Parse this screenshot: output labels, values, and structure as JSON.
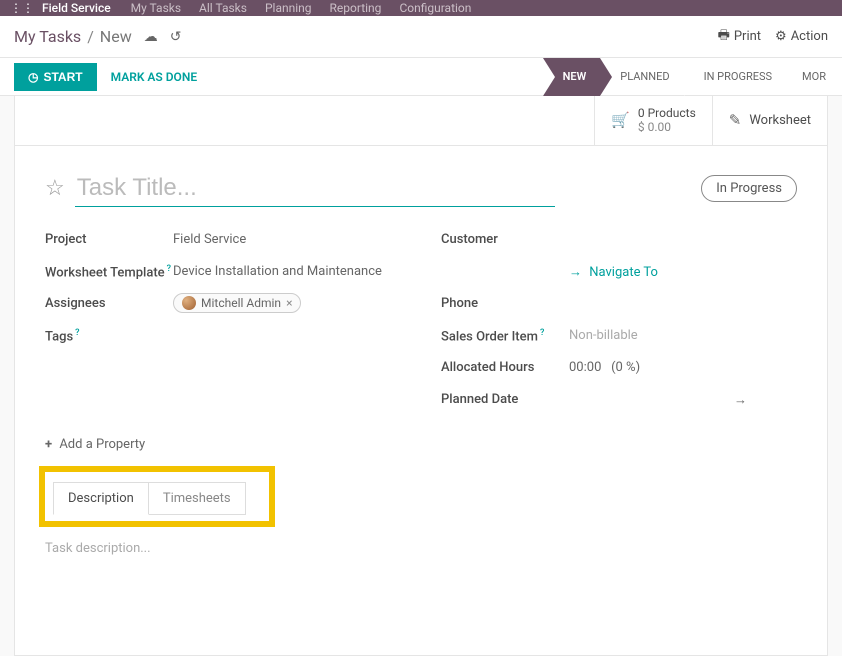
{
  "nav": {
    "brand": "Field Service",
    "items": [
      "My Tasks",
      "All Tasks",
      "Planning",
      "Reporting",
      "Configuration"
    ]
  },
  "breadcrumb": {
    "root": "My Tasks",
    "current": "New"
  },
  "subhead": {
    "print": "Print",
    "action": "Action"
  },
  "buttons": {
    "start": "START",
    "done": "MARK AS DONE"
  },
  "stages": {
    "new": "NEW",
    "planned": "PLANNED",
    "in_progress": "IN PROGRESS",
    "more": "MOR"
  },
  "infobtn": {
    "products_line1": "0 Products",
    "products_line2": "$ 0.00",
    "worksheet": "Worksheet"
  },
  "title": {
    "placeholder": "Task Title...",
    "status_pill": "In Progress"
  },
  "labels": {
    "project": "Project",
    "worksheet_template": "Worksheet Template",
    "assignees": "Assignees",
    "tags": "Tags",
    "customer": "Customer",
    "navigate_to": "Navigate To",
    "phone": "Phone",
    "sales_order_item": "Sales Order Item",
    "allocated_hours": "Allocated Hours",
    "planned_date": "Planned Date",
    "add_property": "Add a Property"
  },
  "values": {
    "project": "Field Service",
    "worksheet_template": "Device Installation and Maintenance",
    "assignee_name": "Mitchell Admin",
    "sales_order_item_placeholder": "Non-billable",
    "allocated_hours": "00:00",
    "allocated_pct": "(0 %)",
    "planned_date_arrow": "→"
  },
  "tabs": {
    "description": "Description",
    "timesheets": "Timesheets"
  },
  "desc_placeholder": "Task description..."
}
